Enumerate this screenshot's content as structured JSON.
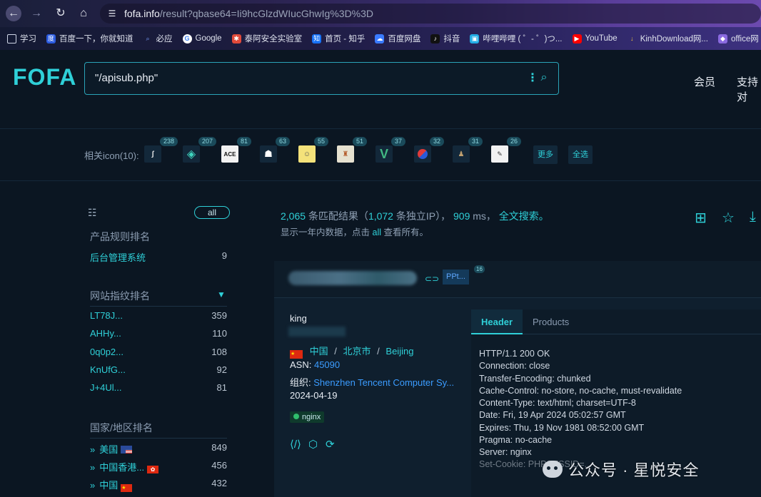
{
  "browser": {
    "url_host": "fofa.info",
    "url_path": "/result?qbase64=Ii9hcGlzdWIucGhwIg%3D%3D",
    "bookmarks": [
      "学习",
      "百度一下，你就知道",
      "必应",
      "Google",
      "泰阿安全实验室",
      "首页 - 知乎",
      "百度网盘",
      "抖音",
      "哔哩哔哩 ( ゜- ゜)つ...",
      "YouTube",
      "KinhDownload网...",
      "office网"
    ]
  },
  "header": {
    "logo": "FOFA",
    "query": "\"/apisub.php\"",
    "nav": [
      "会员",
      "支持对"
    ]
  },
  "related": {
    "label": "相关icon(10):",
    "counts": [
      "238",
      "207",
      "81",
      "63",
      "55",
      "51",
      "37",
      "32",
      "31",
      "26"
    ],
    "more": "更多",
    "select_all": "全选"
  },
  "sidebar": {
    "all": "all",
    "product_title": "产品规则排名",
    "products": [
      {
        "name": "后台管理系统",
        "count": "9"
      }
    ],
    "fingerprint_title": "网站指纹排名",
    "fingerprints": [
      {
        "name": "LT78J...",
        "count": "359"
      },
      {
        "name": "AHHy...",
        "count": "110"
      },
      {
        "name": "0q0p2...",
        "count": "108"
      },
      {
        "name": "KnUfG...",
        "count": "92"
      },
      {
        "name": "J+4Ul...",
        "count": "81"
      }
    ],
    "country_title": "国家/地区排名",
    "countries": [
      {
        "name": "美国",
        "count": "849"
      },
      {
        "name": "中国香港...",
        "count": "456"
      },
      {
        "name": "中国",
        "count": "432"
      }
    ]
  },
  "results": {
    "total": "2,065",
    "total_label": "条匹配结果（",
    "ips": "1,072",
    "ips_label": "条独立IP），",
    "ms": "909",
    "ms_label": "ms，",
    "fulltext": "全文搜索。",
    "sub_prefix": "显示一年内数据，点击",
    "sub_all": "all",
    "sub_suffix": "查看所有。"
  },
  "card": {
    "tag": "PPt...",
    "tag_count": "16",
    "title": "king",
    "country": "中国",
    "city": "北京市",
    "region": "Beijing",
    "asn_label": "ASN:",
    "asn": "45090",
    "org_label": "组织:",
    "org": "Shenzhen Tencent Computer Sy...",
    "date": "2024-04-19",
    "server_tag": "nginx",
    "tabs": [
      "Header",
      "Products"
    ],
    "headers": [
      "HTTP/1.1 200 OK",
      "Connection: close",
      "Transfer-Encoding: chunked",
      "Cache-Control: no-store, no-cache, must-revalidate",
      "Content-Type: text/html; charset=UTF-8",
      "Date: Fri, 19 Apr 2024 05:02:57 GMT",
      "Expires: Thu, 19 Nov 1981 08:52:00 GMT",
      "Pragma: no-cache",
      "Server: nginx",
      "Set-Cookie: PHPSESSID=..."
    ]
  },
  "watermark": "公众号 · 星悦安全"
}
